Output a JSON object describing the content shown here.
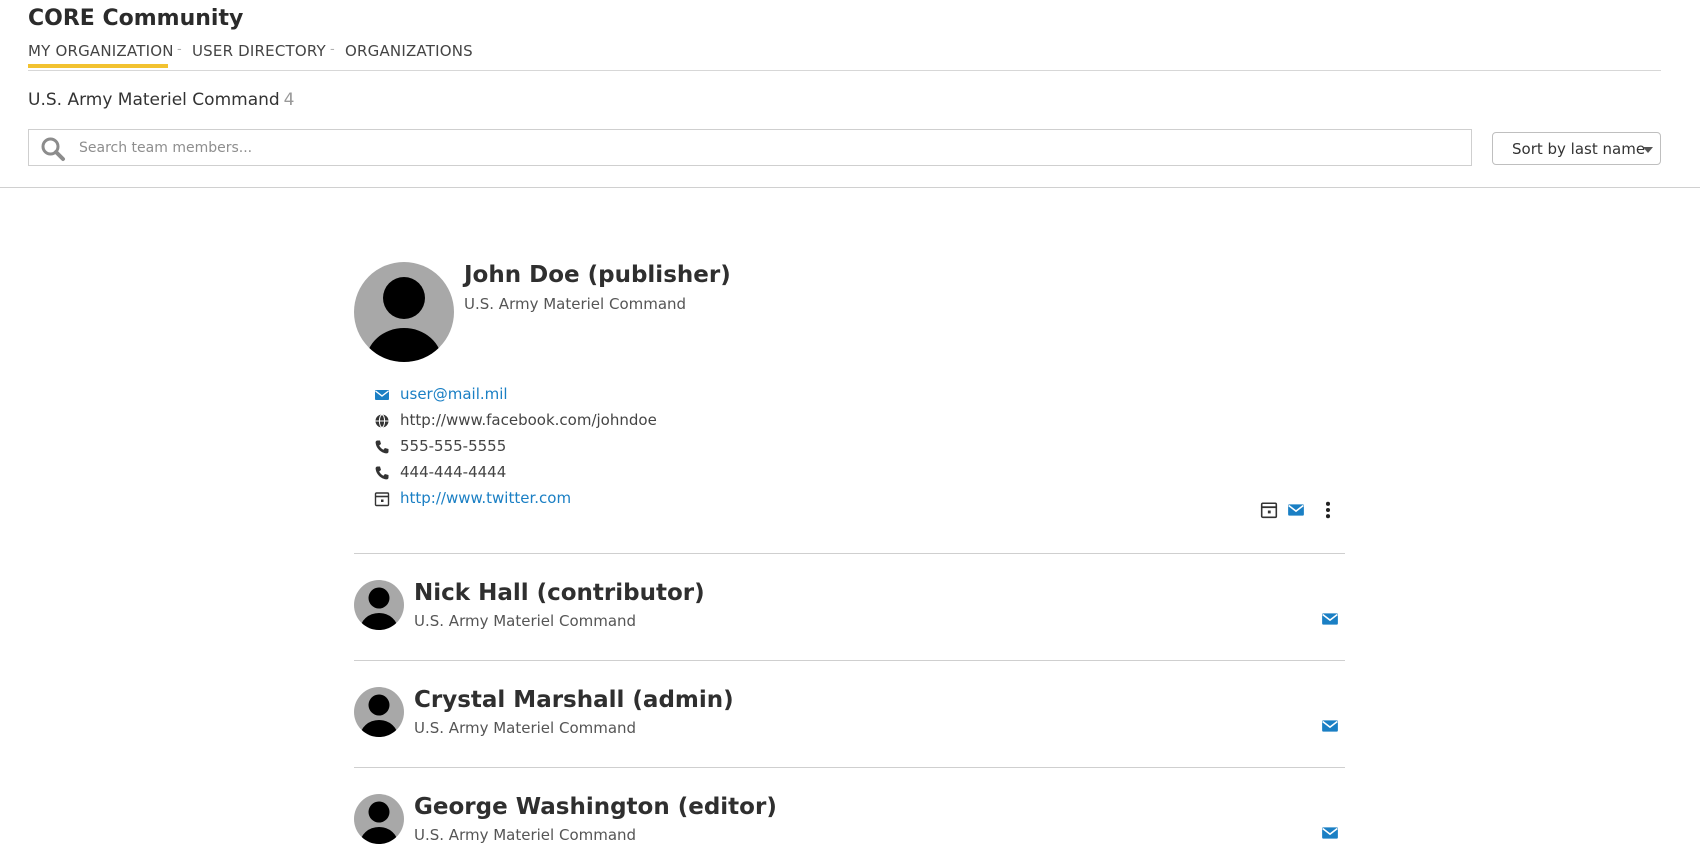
{
  "app": {
    "title": "CORE Community"
  },
  "nav": {
    "tabs": [
      {
        "label": "MY ORGANIZATION",
        "active": true
      },
      {
        "label": "USER DIRECTORY",
        "active": false
      },
      {
        "label": "ORGANIZATIONS",
        "active": false
      }
    ],
    "separator": "-"
  },
  "org": {
    "name": "U.S. Army Materiel Command",
    "member_count": "4"
  },
  "search": {
    "placeholder": "Search team members...",
    "value": ""
  },
  "sort": {
    "selected": "Sort by last name"
  },
  "colors": {
    "accent": "#f2c230",
    "link": "#1a7fc4",
    "avatar_bg": "#a8a8a8"
  },
  "members": [
    {
      "name": "John Doe (publisher)",
      "org": "U.S. Army Materiel Command",
      "contacts": [
        {
          "icon": "envelope-icon",
          "text": "user@mail.mil",
          "is_link": true
        },
        {
          "icon": "globe-icon",
          "text": "http://www.facebook.com/johndoe",
          "is_link": false
        },
        {
          "icon": "phone-icon",
          "text": "555-555-5555",
          "is_link": false
        },
        {
          "icon": "phone-icon",
          "text": "444-444-4444",
          "is_link": false
        },
        {
          "icon": "calendar-icon",
          "text": "http://www.twitter.com",
          "is_link": true
        }
      ],
      "actions": [
        "calendar-icon",
        "envelope-icon",
        "more-vertical-icon"
      ]
    },
    {
      "name": "Nick Hall (contributor)",
      "org": "U.S. Army Materiel Command",
      "actions": [
        "envelope-icon"
      ]
    },
    {
      "name": "Crystal Marshall (admin)",
      "org": "U.S. Army Materiel Command",
      "actions": [
        "envelope-icon"
      ]
    },
    {
      "name": "George Washington (editor)",
      "org": "U.S. Army Materiel Command",
      "actions": [
        "envelope-icon"
      ]
    }
  ]
}
